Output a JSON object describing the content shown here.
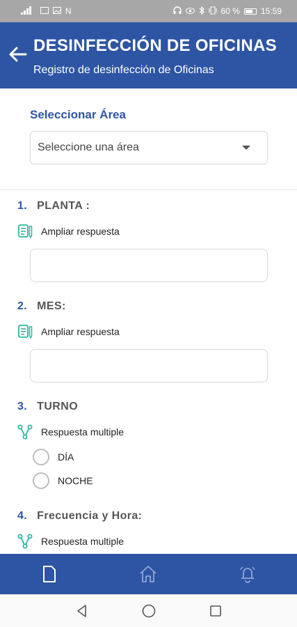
{
  "status_bar": {
    "left_text": "N",
    "battery": "60 %",
    "time": "15:59"
  },
  "header": {
    "title": "DESINFECCIÓN DE OFICINAS",
    "subtitle": "Registro de desinfección de Oficinas",
    "back_icon": "arrow-left-icon"
  },
  "area": {
    "label": "Seleccionar Área",
    "selected": "Seleccione una área"
  },
  "questions": [
    {
      "number": "1.",
      "title": "PLANTA :",
      "type_label": "Ampliar respuesta",
      "type_icon": "document-pen-icon",
      "value": ""
    },
    {
      "number": "2.",
      "title": "MES:",
      "type_label": "Ampliar respuesta",
      "type_icon": "document-pen-icon",
      "value": ""
    },
    {
      "number": "3.",
      "title": "TURNO",
      "type_label": "Respuesta multiple",
      "type_icon": "branch-icon",
      "options": [
        "DÍA",
        "NOCHE"
      ]
    },
    {
      "number": "4.",
      "title": "Frecuencia y Hora:",
      "type_label": "Respuesta multiple",
      "type_icon": "branch-icon"
    }
  ],
  "bottom_nav": {
    "items": [
      "document-icon",
      "home-icon",
      "bell-icon"
    ]
  },
  "system_nav": {
    "items": [
      "back-triangle-icon",
      "home-circle-icon",
      "recents-square-icon"
    ]
  },
  "colors": {
    "primary": "#2e55a3",
    "accent_icon": "#2bb7a0",
    "status_bar": "#a7a7a7"
  }
}
